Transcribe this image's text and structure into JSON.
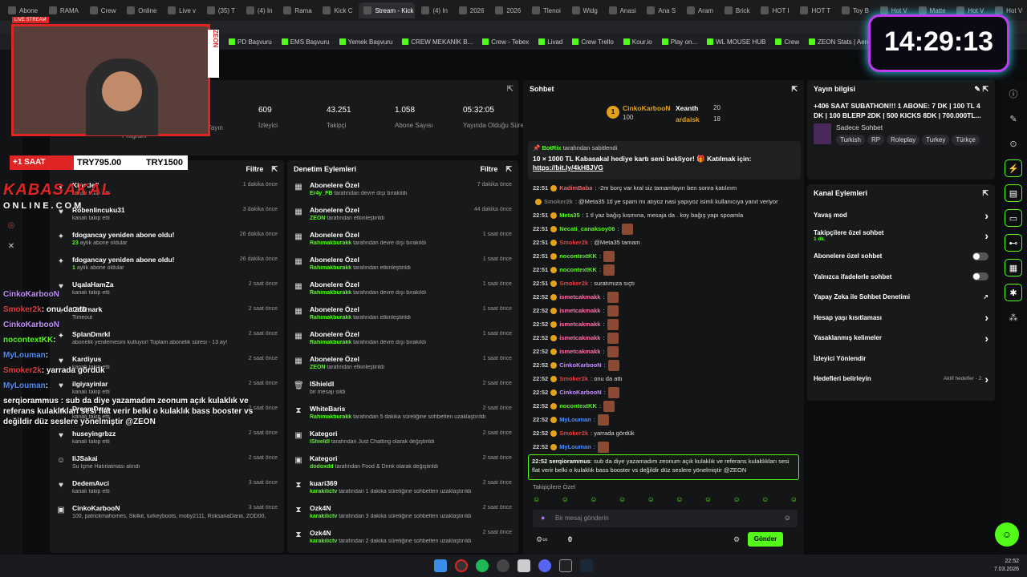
{
  "browser": {
    "tabs": [
      "Abone",
      "RAMA",
      "Crew",
      "Online",
      "Live v",
      "(35) T",
      "(4) In",
      "Rama",
      "Kick C",
      "Stream - Kick",
      "(4) In",
      "2026",
      "2026",
      "Tlenoi",
      "Widg",
      "Anasi",
      "Ana S",
      "Aram",
      "Brick",
      "HOT I",
      "HOT T",
      "Toy B",
      "Hot V",
      "Matte",
      "Hot V",
      "Hot V"
    ],
    "active_tab": "Stream - Kick",
    "address": "dashboard.kick.com/stream",
    "bookmarks": [
      "PD Başvuru",
      "EMS Başvuru",
      "Yemek Başvuru",
      "CREW MEKANİK B...",
      "Crew - Tebex",
      "Livad",
      "Crew Trello",
      "Kour.io",
      "Play on...",
      "WL MOUSE HUB",
      "Crew",
      "ZEON Stats | Aero...",
      "APIq"
    ]
  },
  "clock": "14:29:13",
  "stats": {
    "items": [
      {
        "value": "609",
        "label": "İzleyici"
      },
      {
        "value": "43.251",
        "label": "Takipçi"
      },
      {
        "value": "1.058",
        "label": "Abone Sayısı"
      },
      {
        "value": "05:32:05",
        "label": "Yayında Olduğu Süre"
      }
    ],
    "partial_label_1": "Yayın",
    "partial_label_2": "Program"
  },
  "activity": {
    "filter": "Filtre",
    "rows": [
      {
        "title": "Kinsdefi",
        "sub": "kanalı takip etti",
        "time": "1 dakika önce"
      },
      {
        "title": "Robenlincuku31",
        "sub": "kanalı takip etti",
        "time": "3 dakika önce"
      },
      {
        "title": "fdogancay yeniden abone oldu!",
        "sub": "aylık abone oldular",
        "hl": "23",
        "time": "26 dakika önce"
      },
      {
        "title": "fdogancay yeniden abone oldu!",
        "sub": "aylık abone oldular",
        "hl": "1",
        "time": "26 dakika önce"
      },
      {
        "title": "UqalaHamZa",
        "sub": "kanalı takip etti",
        "time": "2 saat önce"
      },
      {
        "title": "Oddmark",
        "sub": "Timeout",
        "time": "2 saat önce"
      },
      {
        "title": "SplanDmrkl",
        "sub": "abonelik yenilemesini kutluyor! Toplam abonelik süresi - 13 ay!",
        "time": "2 saat önce"
      },
      {
        "title": "Kardiyus",
        "sub": "kanalı takip etti",
        "time": "2 saat önce"
      },
      {
        "title": "ilgiyayinlar",
        "sub": "kanalı takip etti",
        "time": "2 saat önce"
      },
      {
        "title": "DreamDayz",
        "sub": "kanalı takip etti",
        "time": "2 saat önce"
      },
      {
        "title": "huseyingrbzz",
        "sub": "kanalı takip etti",
        "time": "2 saat önce"
      },
      {
        "title": "IlJSakai",
        "sub": "Su İçme Hatırlatması alındı",
        "time": "2 saat önce"
      },
      {
        "title": "DedemAvci",
        "sub": "kanalı takip etti",
        "time": "3 saat önce"
      },
      {
        "title": "CinkoKarbooN",
        "sub": "100, patrickmahomes, Skilkit, turkeyboots, moby2111, RoksanaDaria, ZOD00,",
        "time": "3 saat önce"
      }
    ]
  },
  "moderation": {
    "title": "Denetim Eylemleri",
    "filter": "Filtre",
    "rows": [
      {
        "title": "Abonelere Özel",
        "user": "Er4y_FB",
        "sub": "tarafından devre dışı bırakıldı",
        "time": "7 dakika önce"
      },
      {
        "title": "Abonelere Özel",
        "user": "ZEON",
        "sub": "tarafından etkinleştirildi",
        "time": "44 dakika önce"
      },
      {
        "title": "Abonelere Özel",
        "user": "Rahimakburakk",
        "sub": "tarafından devre dışı bırakıldı",
        "time": "1 saat önce"
      },
      {
        "title": "Abonelere Özel",
        "user": "Rahimakburakk",
        "sub": "tarafından etkinleştirildi",
        "time": "1 saat önce"
      },
      {
        "title": "Abonelere Özel",
        "user": "Rahimakburakk",
        "sub": "tarafından devre dışı bırakıldı",
        "time": "1 saat önce"
      },
      {
        "title": "Abonelere Özel",
        "user": "Rahimakburakk",
        "sub": "tarafından etkinleştirildi",
        "time": "1 saat önce"
      },
      {
        "title": "Abonelere Özel",
        "user": "Rahimakburakk",
        "sub": "tarafından devre dışı bırakıldı",
        "time": "1 saat önce"
      },
      {
        "title": "Abonelere Özel",
        "user": "ZEON",
        "sub": "tarafından etkinleştirildi",
        "time": "1 saat önce"
      },
      {
        "title": "IShieldI",
        "user": "",
        "sub": "bir mesajı sildi",
        "time": "2 saat önce"
      },
      {
        "title": "WhiteBaris",
        "user": "Rahimakburakk",
        "sub": "tarafından 5 dakika süreliğine sohbetten uzaklaştırıldı",
        "time": "2 saat önce"
      },
      {
        "title": "Kategori",
        "user": "IShieldI",
        "sub": "tarafından Just Chatting olarak değiştirildi",
        "time": "2 saat önce"
      },
      {
        "title": "Kategori",
        "user": "dodoxdd",
        "sub": "tarafından Food & Drink olarak değiştirildi",
        "time": "2 saat önce"
      },
      {
        "title": "kuari369",
        "user": "karakilictv",
        "sub": "tarafından 1 dakika süreliğine sohbetten uzaklaştırıldı",
        "time": "2 saat önce"
      },
      {
        "title": "Ozk4N",
        "user": "karakilictv",
        "sub": "tarafından 3 dakika süreliğine sohbetten uzaklaştırıldı",
        "time": "2 saat önce"
      },
      {
        "title": "Ozk4N",
        "user": "karakilictv",
        "sub": "tarafından 2 dakika süreliğine sohbetten uzaklaştırıldı",
        "time": "2 saat önce"
      }
    ]
  },
  "chat": {
    "title": "Sohbet",
    "leaders": [
      {
        "name": "CinkoKarbooN",
        "count": "100"
      },
      {
        "name": "Xeanth",
        "count": "20"
      },
      {
        "name": "ardaisk",
        "count": "18"
      }
    ],
    "pinned_by": "BotRix",
    "pinned_suffix": "tarafından sabitlendi",
    "pinned_text": "10 × 1000 TL Kabasakal hediye kartı seni bekliyor! 🎁 Katılmak için:",
    "pinned_link": "https://bit.ly/4kH8JVG",
    "messages": [
      {
        "time": "22:51",
        "user": "KadimBaba",
        "text": ": -2m borç var kral siz tamamlayın ben sonra katılırım",
        "color": "#d66"
      },
      {
        "time": "",
        "user": "Smoker2k",
        "text": ": @Meta35 1tl ye spam mı atıyoz nasi yapıyoz isimli kullanıcıya yanıt veriyor",
        "color": "#777"
      },
      {
        "time": "22:51",
        "user": "Meta35",
        "text": ": 1 tl yaz bağış kısmına, mesaja da . koy bağış yapı spoamla",
        "color": "#53fc18"
      },
      {
        "time": "22:51",
        "user": "Necati_canaksoy06",
        "text": ":",
        "color": "#53fc18"
      },
      {
        "time": "22:51",
        "user": "Smoker2k",
        "text": ": @Meta35 tamam",
        "color": "#e04040"
      },
      {
        "time": "22:51",
        "user": "nocontextKK",
        "text": ":",
        "color": "#53fc18"
      },
      {
        "time": "22:51",
        "user": "nocontextKK",
        "text": ":",
        "color": "#53fc18"
      },
      {
        "time": "22:51",
        "user": "Smoker2k",
        "text": ": suratımıza sıçtı",
        "color": "#e04040"
      },
      {
        "time": "22:52",
        "user": "ismetcakmakk",
        "text": ":",
        "color": "#ff6fa8"
      },
      {
        "time": "22:52",
        "user": "ismetcakmakk",
        "text": ":",
        "color": "#ff6fa8"
      },
      {
        "time": "22:52",
        "user": "ismetcakmakk",
        "text": ":",
        "color": "#ff6fa8"
      },
      {
        "time": "22:52",
        "user": "ismetcakmakk",
        "text": ":",
        "color": "#ff6fa8"
      },
      {
        "time": "22:52",
        "user": "ismetcakmakk",
        "text": ":",
        "color": "#ff6fa8"
      },
      {
        "time": "22:52",
        "user": "CinkoKarbooN",
        "text": ":",
        "color": "#c38fff"
      },
      {
        "time": "22:52",
        "user": "Smoker2k",
        "text": ": onu da attı",
        "color": "#e04040"
      },
      {
        "time": "22:52",
        "user": "CinkoKarbooN",
        "text": ":",
        "color": "#c38fff"
      },
      {
        "time": "22:52",
        "user": "nocontextKK",
        "text": ":",
        "color": "#53fc18"
      },
      {
        "time": "22:52",
        "user": "MyLouman",
        "text": ":",
        "color": "#4c8dff"
      },
      {
        "time": "22:52",
        "user": "Smoker2k",
        "text": ": yarrada gördük",
        "color": "#e04040"
      },
      {
        "time": "22:52",
        "user": "MyLouman",
        "text": ":",
        "color": "#4c8dff"
      }
    ],
    "highlight": {
      "time": "22:52",
      "user": "serqiorammus",
      "text": ": sub da diye yazamadım zeonum açık kulaklık ve referans kulaklıkları sesi flat verir belki o kulaklık bass booster vs değildir düz seslere yönelmiştir @ZEON"
    },
    "follower_mode": "Takipçilere Özel",
    "input_placeholder": "Bir mesaj gönderin",
    "points": "0",
    "send": "Gönder"
  },
  "info": {
    "title": "Yayın bilgisi",
    "stream_title": "+406 SAAT SUBATHON!!! 1 ABONE: 7 DK | 100 TL 4 DK | 100 BLERP 2DK | 500 KICKS 8DK | 700.000TL...",
    "category": "Sadece Sohbet",
    "tags": [
      "Turkish",
      "RP",
      "Roleplay",
      "Turkey",
      "Türkçe"
    ]
  },
  "channel_actions": {
    "title": "Kanal Eylemleri",
    "items": [
      {
        "label": "Yavaş mod",
        "kind": "chevron"
      },
      {
        "label": "Takipçilere özel sohbet",
        "sub": "1 dk.",
        "kind": "chevron"
      },
      {
        "label": "Abonelere özel sohbet",
        "kind": "toggle"
      },
      {
        "label": "Yalnızca ifadelerle sohbet",
        "kind": "toggle"
      },
      {
        "label": "Yapay Zeka ile Sohbet Denetimi",
        "kind": "ext"
      },
      {
        "label": "Hesap yaşı kısıtlaması",
        "kind": "chevron"
      },
      {
        "label": "Yasaklanmış kelimeler",
        "kind": "chevron"
      },
      {
        "label": "İzleyici Yönlendir",
        "kind": "none"
      },
      {
        "label": "Hedefleri belirleyin",
        "sub": "Aktif hedefler - 2",
        "kind": "chevron"
      }
    ]
  },
  "overlay": {
    "live_label": "LIVE STREAM",
    "zeon": "ZEON",
    "sub_label": "+1 SAAT",
    "try1": "TRY795.00",
    "try2": "TRY1500",
    "brand1": "KABASAKAL",
    "brand2": "ONLINE.COM",
    "chat": [
      {
        "user": "CinkoKarbooN",
        "text": "",
        "color": "#c38fff"
      },
      {
        "user": "Smoker2k",
        "text": ": onu da attı",
        "color": "#e04040"
      },
      {
        "user": "CinkoKarbooN",
        "text": "",
        "color": "#c38fff"
      },
      {
        "user": "nocontextKK",
        "text": ":",
        "color": "#53fc18"
      },
      {
        "user": "MyLouman",
        "text": ":",
        "color": "#4c8dff"
      },
      {
        "user": "Smoker2k",
        "text": ": yarrada gördük",
        "color": "#e04040"
      },
      {
        "user": "MyLouman",
        "text": ":",
        "color": "#4c8dff"
      }
    ],
    "long_msg": "serqiorammus : sub da diye yazamadım zeonum açık kulaklık ve referans kulaklıkları sesi flat verir belki o kulaklık bass booster vs değildir düz seslere yönelmiştir @ZEON"
  },
  "taskbar": {
    "time": "22:52",
    "date": "7.03.2026"
  }
}
